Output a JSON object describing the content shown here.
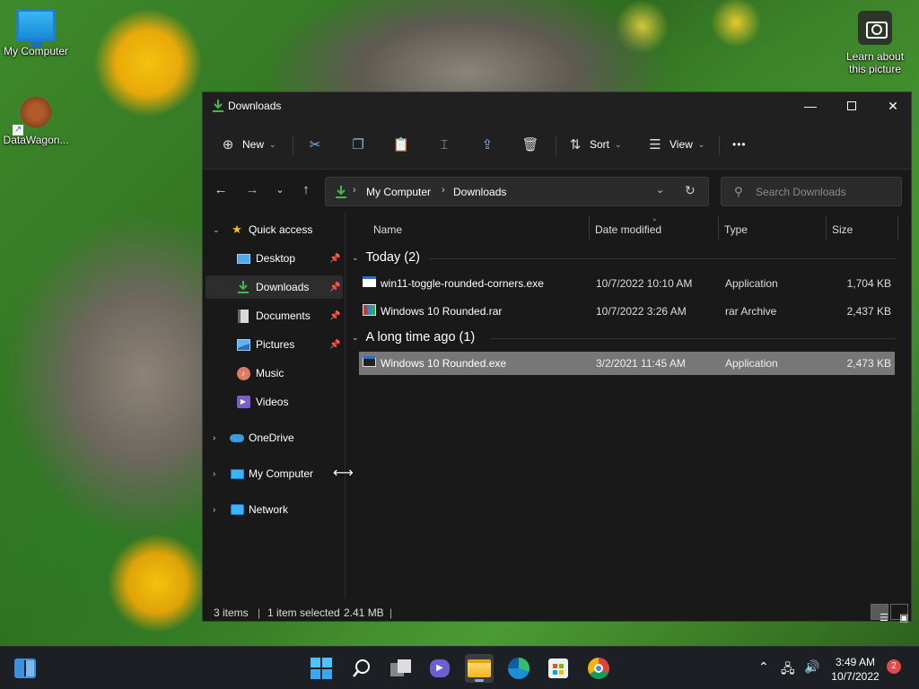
{
  "desktop": {
    "icons": [
      {
        "label": "My Computer"
      },
      {
        "label": "DataWagon..."
      },
      {
        "label": "Learn about this picture"
      }
    ]
  },
  "window": {
    "title": "Downloads",
    "commands": {
      "new_label": "New",
      "sort_label": "Sort",
      "view_label": "View",
      "more_label": "•••"
    },
    "address": {
      "crumbs": [
        "My Computer",
        "Downloads"
      ]
    },
    "search": {
      "placeholder": "Search Downloads"
    },
    "sidebar": {
      "items": [
        {
          "label": "Quick access",
          "icon": "star-icon"
        },
        {
          "label": "Desktop",
          "icon": "desktop-icon"
        },
        {
          "label": "Downloads",
          "icon": "download-icon"
        },
        {
          "label": "Documents",
          "icon": "documents-icon"
        },
        {
          "label": "Pictures",
          "icon": "pictures-icon"
        },
        {
          "label": "Music",
          "icon": "music-icon"
        },
        {
          "label": "Videos",
          "icon": "videos-icon"
        },
        {
          "label": "OneDrive",
          "icon": "onedrive-icon"
        },
        {
          "label": "My Computer",
          "icon": "computer-icon"
        },
        {
          "label": "Network",
          "icon": "network-icon"
        }
      ]
    },
    "columns": [
      "Name",
      "Date modified",
      "Type",
      "Size"
    ],
    "groups": [
      {
        "label": "Today (2)",
        "files": [
          {
            "name": "win11-toggle-rounded-corners.exe",
            "date": "10/7/2022 10:10 AM",
            "type": "Application",
            "size": "1,704 KB"
          },
          {
            "name": "Windows 10 Rounded.rar",
            "date": "10/7/2022 3:26 AM",
            "type": "rar Archive",
            "size": "2,437 KB"
          }
        ]
      },
      {
        "label": "A long time ago (1)",
        "files": [
          {
            "name": "Windows 10 Rounded.exe",
            "date": "3/2/2021 11:45 AM",
            "type": "Application",
            "size": "2,473 KB"
          }
        ]
      }
    ],
    "status": {
      "items_count": "3 items",
      "selection": "1 item selected",
      "selection_size": "2.41 MB"
    }
  },
  "taskbar": {
    "clock_time": "3:49 AM",
    "clock_date": "10/7/2022",
    "notification_count": "2"
  },
  "colors": {
    "accent": "#7ab7ea",
    "download_green": "#3fb950",
    "selected_row": "#777777"
  }
}
